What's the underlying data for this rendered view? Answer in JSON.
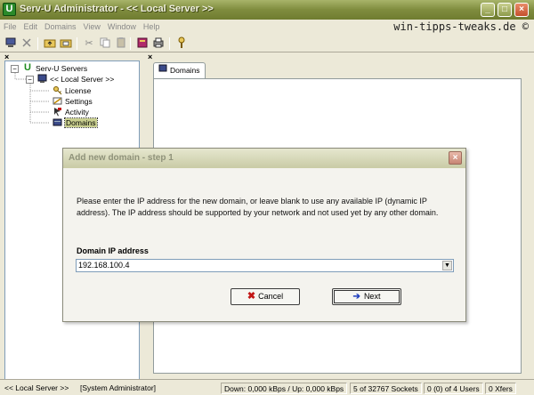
{
  "window": {
    "title": "Serv-U Administrator - << Local Server >>",
    "watermark": "win-tipps-tweaks.de ©",
    "min_glyph": "_",
    "max_glyph": "□",
    "close_glyph": "×"
  },
  "menu": [
    "File",
    "Edit",
    "Domains",
    "View",
    "Window",
    "Help"
  ],
  "tree": {
    "root": "Serv-U Servers",
    "server": "<< Local Server >>",
    "items": [
      "License",
      "Settings",
      "Activity",
      "Domains"
    ],
    "selected": "Domains"
  },
  "tab": {
    "label": "Domains"
  },
  "dialog": {
    "title": "Add new domain - step 1",
    "instructions": "Please enter the IP address for the new domain, or leave blank to use any available IP (dynamic IP address). The IP address should be supported by your network and not used yet by any other domain.",
    "field_label": "Domain IP address",
    "field_value": "192.168.100.4",
    "cancel_label": "Cancel",
    "next_label": "Next"
  },
  "status": {
    "server": "<< Local Server >>",
    "user": "[System Administrator]",
    "bandwidth": "Down: 0,000 kBps / Up: 0,000 kBps",
    "sockets": "5 of 32767 Sockets",
    "users": "0 (0) of 4 Users",
    "xfers": "0 Xfers"
  },
  "colors": {
    "titlebar": "#7f8c3e",
    "selection": "#c9cf8f",
    "cancel_icon": "#c21616",
    "next_icon": "#1f3fbf"
  }
}
